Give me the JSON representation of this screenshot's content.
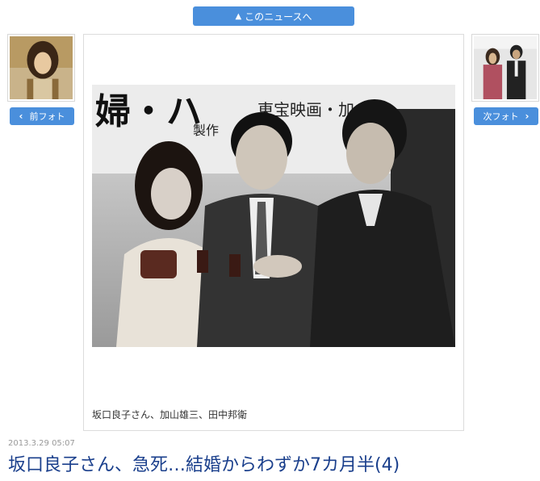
{
  "header": {
    "news_button_label": "このニュースへ"
  },
  "nav": {
    "prev_label": "前フォト",
    "next_label": "次フォト"
  },
  "photo": {
    "caption": "坂口良子さん、加山雄三、田中邦衛",
    "sign_text_1": "東宝映画・加山",
    "sign_text_2": "製作"
  },
  "article": {
    "timestamp": "2013.3.29 05:07",
    "title": "坂口良子さん、急死…結婚からわずか7カ月半(4)"
  },
  "colors": {
    "accent": "#4a8fdc",
    "headline": "#1a3f8c"
  }
}
